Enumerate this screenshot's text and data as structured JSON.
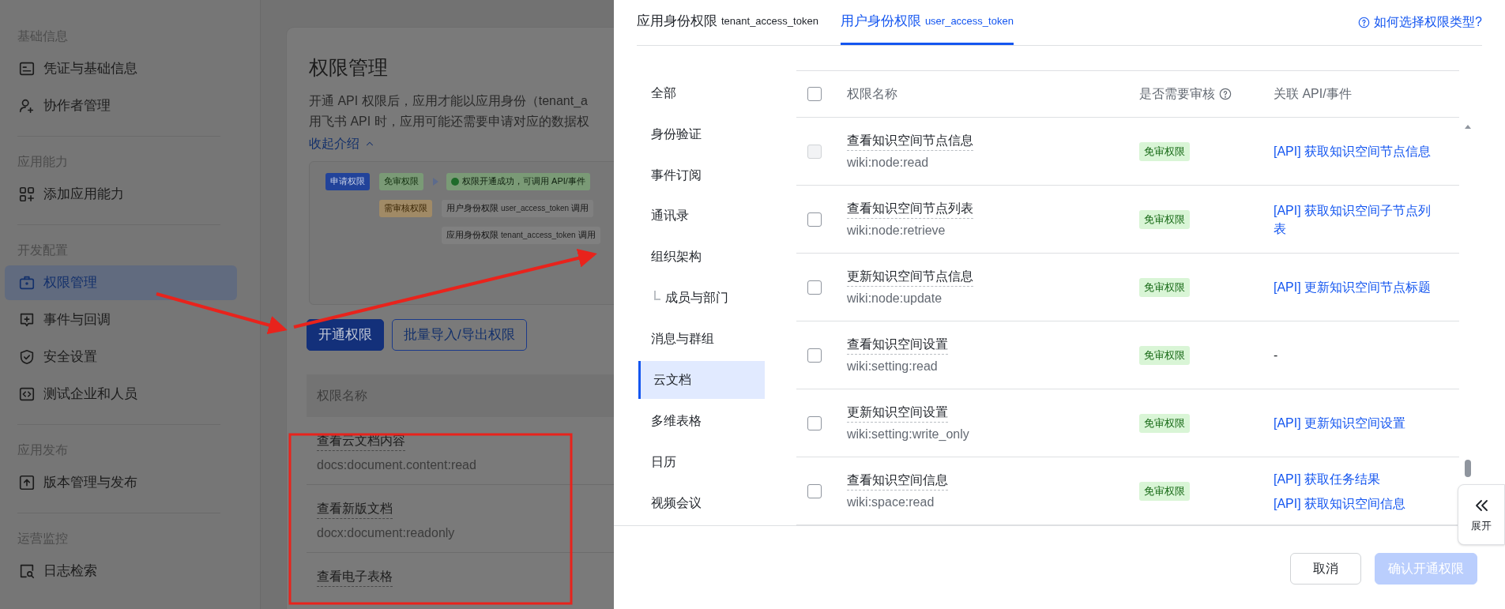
{
  "sidebar": {
    "sections": [
      {
        "title": "基础信息",
        "items": [
          {
            "label": "凭证与基础信息",
            "selected": false
          },
          {
            "label": "协作者管理",
            "selected": false
          }
        ]
      },
      {
        "title": "应用能力",
        "items": [
          {
            "label": "添加应用能力",
            "selected": false
          }
        ]
      },
      {
        "title": "开发配置",
        "items": [
          {
            "label": "权限管理",
            "selected": true
          },
          {
            "label": "事件与回调",
            "selected": false
          },
          {
            "label": "安全设置",
            "selected": false
          },
          {
            "label": "测试企业和人员",
            "selected": false
          }
        ]
      },
      {
        "title": "应用发布",
        "items": [
          {
            "label": "版本管理与发布",
            "selected": false
          }
        ]
      },
      {
        "title": "运营监控",
        "items": [
          {
            "label": "日志检索",
            "selected": false
          }
        ]
      }
    ]
  },
  "page": {
    "title": "权限管理",
    "description_lines": [
      "开通 API 权限后，应用才能以应用身份（tenant_a",
      "用飞书 API 时，应用可能还需要申请对应的数据权"
    ],
    "collapse_link": "收起介绍",
    "diagram": {
      "start": "申请权限",
      "branches": [
        {
          "tag": "免审权限",
          "kind": "auto",
          "results": [
            {
              "kind": "success",
              "label": "权限开通成功，可调用 API/事件"
            }
          ]
        },
        {
          "tag": "需审核权限",
          "kind": "review",
          "results": [
            {
              "kind": "token",
              "label": "用户身份权限",
              "token": "user_access_token",
              "suffix": "调用"
            },
            {
              "kind": "token",
              "label": "应用身份权限",
              "token": "tenant_access_token",
              "suffix": "调用"
            }
          ]
        }
      ]
    },
    "buttons": [
      {
        "label": "开通权限",
        "kind": "primary"
      },
      {
        "label": "批量导入/导出权限",
        "kind": "outline"
      }
    ],
    "table": {
      "columns": [
        "权限名称"
      ],
      "rows": [
        {
          "name": "查看云文档内容",
          "scope": "docs:document.content:read"
        },
        {
          "name": "查看新版文档",
          "scope": "docx:document:readonly"
        },
        {
          "name": "查看电子表格"
        }
      ]
    }
  },
  "drawer": {
    "tabs": [
      {
        "label": "应用身份权限",
        "token": "tenant_access_token",
        "selected": false
      },
      {
        "label": "用户身份权限",
        "token": "user_access_token",
        "selected": true
      }
    ],
    "help_link": "如何选择权限类型?",
    "categories": [
      {
        "label": "全部",
        "selected": false
      },
      {
        "label": "身份验证",
        "selected": false
      },
      {
        "label": "事件订阅",
        "selected": false
      },
      {
        "label": "通讯录",
        "selected": false
      },
      {
        "label": "组织架构",
        "selected": false,
        "children": [
          {
            "label": "成员与部门",
            "selected": false
          }
        ]
      },
      {
        "label": "消息与群组",
        "selected": false
      },
      {
        "label": "云文档",
        "selected": true
      },
      {
        "label": "多维表格",
        "selected": false
      },
      {
        "label": "日历",
        "selected": false
      },
      {
        "label": "视频会议",
        "selected": false
      }
    ],
    "table": {
      "select_all": {
        "checked": false
      },
      "columns": [
        "权限名称",
        "是否需要审核",
        "关联 API/事件"
      ],
      "rows": [
        {
          "checked": false,
          "disabled": true,
          "name": "查看知识空间节点信息",
          "scope": "wiki:node:read",
          "review": "免审权限",
          "apis": [
            {
              "kind": "link",
              "text": "[API] 获取知识空间节点信息"
            }
          ]
        },
        {
          "checked": false,
          "disabled": false,
          "name": "查看知识空间节点列表",
          "scope": "wiki:node:retrieve",
          "review": "免审权限",
          "apis": [
            {
              "kind": "link",
              "text": "[API] 获取知识空间子节点列表"
            }
          ]
        },
        {
          "checked": false,
          "disabled": false,
          "name": "更新知识空间节点信息",
          "scope": "wiki:node:update",
          "review": "免审权限",
          "apis": [
            {
              "kind": "link",
              "text": "[API] 更新知识空间节点标题"
            }
          ]
        },
        {
          "checked": false,
          "disabled": false,
          "name": "查看知识空间设置",
          "scope": "wiki:setting:read",
          "review": "免审权限",
          "apis": [
            {
              "kind": "none",
              "text": "-"
            }
          ]
        },
        {
          "checked": false,
          "disabled": false,
          "name": "更新知识空间设置",
          "scope": "wiki:setting:write_only",
          "review": "免审权限",
          "apis": [
            {
              "kind": "link",
              "text": "[API] 更新知识空间设置"
            }
          ]
        },
        {
          "checked": false,
          "disabled": false,
          "name": "查看知识空间信息",
          "scope": "wiki:space:read",
          "review": "免审权限",
          "apis": [
            {
              "kind": "link",
              "text": "[API] 获取任务结果"
            },
            {
              "kind": "link",
              "text": "[API] 获取知识空间信息"
            }
          ]
        }
      ]
    },
    "footer_buttons": [
      {
        "label": "取消",
        "disabled": false
      },
      {
        "label": "确认开通权限",
        "disabled": true
      }
    ],
    "expand_tab": {
      "label": "展开"
    }
  }
}
